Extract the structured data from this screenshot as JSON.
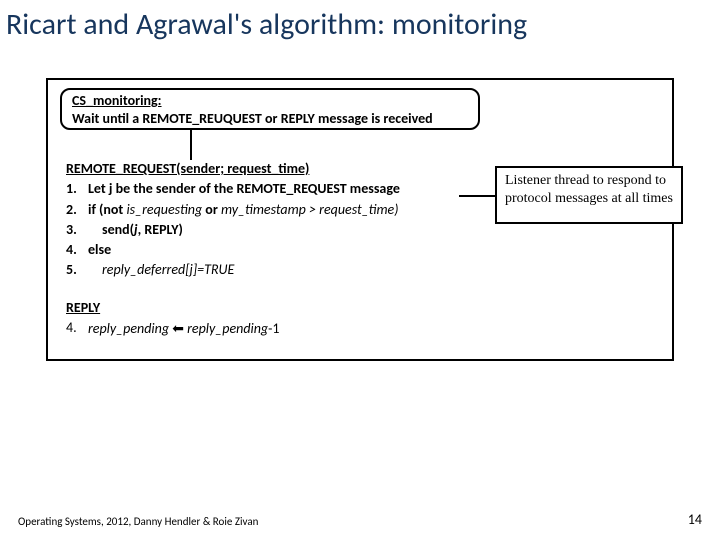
{
  "title": "Ricart and Agrawal's algorithm: monitoring",
  "cs_box": {
    "header": "CS_monitoring:",
    "body": "Wait until a REMOTE_REUQUEST or REPLY message is received"
  },
  "remote": {
    "signature": "REMOTE_REQUEST(sender; request_time)",
    "lines": [
      {
        "num": "1.",
        "text": "Let j be the sender of the REMOTE_REQUEST message",
        "style": "bold"
      },
      {
        "num": "2.",
        "pre": "if (not ",
        "ital1": "is_requesting",
        "mid": " or ",
        "ital2": "my_timestamp > request_time)",
        "style": "ifline"
      },
      {
        "num": "3.",
        "text_pre": "send(",
        "ital": "j",
        "text_post": ", REPLY)",
        "style": "indent-bold"
      },
      {
        "num": "4.",
        "text": "else",
        "style": "bold"
      },
      {
        "num": "5.",
        "text": "reply_deferred[j]=TRUE",
        "style": "indent-ital"
      }
    ]
  },
  "reply": {
    "signature": "REPLY",
    "num": "4.",
    "var1": "reply_pending",
    "arrow": "⬅",
    "var2": "reply_pending",
    "suffix": "-1"
  },
  "note": "Listener thread to respond to protocol messages at all times",
  "footer": "Operating Systems, 2012, Danny Hendler & Roie Zivan",
  "page": "14"
}
